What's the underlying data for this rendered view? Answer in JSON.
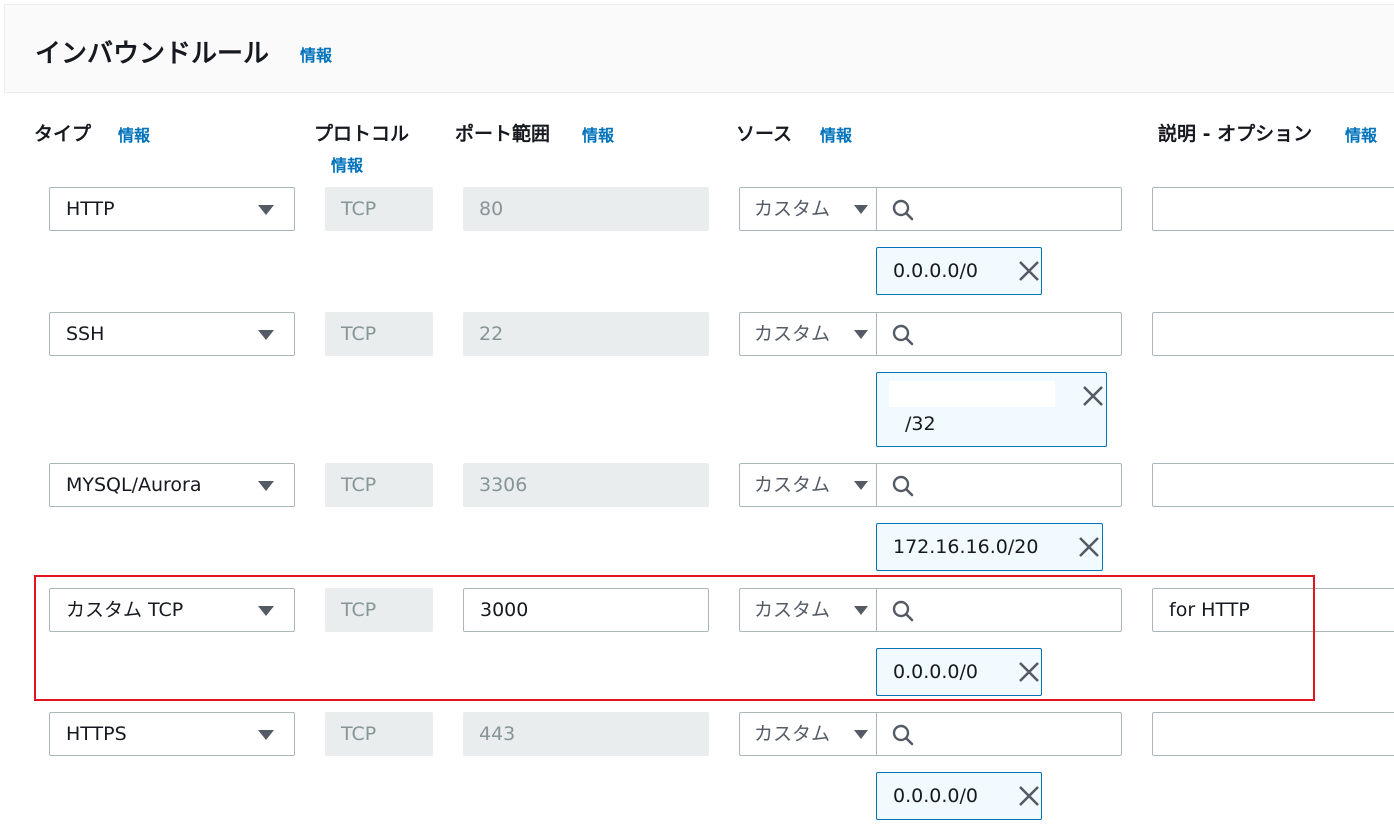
{
  "header": {
    "title": "インバウンドルール",
    "info": "情報"
  },
  "columns": {
    "type": "タイプ",
    "protocol": "プロトコル",
    "port": "ポート範囲",
    "source": "ソース",
    "description": "説明 - オプション",
    "info": "情報"
  },
  "source_mode": "カスタム",
  "rules": [
    {
      "type": "HTTP",
      "protocol": "TCP",
      "port": "80",
      "source": "0.0.0.0/0",
      "description": ""
    },
    {
      "type": "SSH",
      "protocol": "TCP",
      "port": "22",
      "source": "/32",
      "description": ""
    },
    {
      "type": "MYSQL/Aurora",
      "protocol": "TCP",
      "port": "3306",
      "source": "172.16.16.0/20",
      "description": ""
    },
    {
      "type": "カスタム TCP",
      "protocol": "TCP",
      "port": "3000",
      "source": "0.0.0.0/0",
      "description": "for HTTP"
    },
    {
      "type": "HTTPS",
      "protocol": "TCP",
      "port": "443",
      "source": "0.0.0.0/0",
      "description": ""
    }
  ],
  "icons": {
    "search": "search-icon",
    "remove": "close-icon",
    "dropdown": "caret-down-icon"
  },
  "colors": {
    "link": "#0073bb",
    "highlight_border": "#e0151f",
    "token_border": "#0073bb",
    "token_bg": "#f1faff"
  }
}
